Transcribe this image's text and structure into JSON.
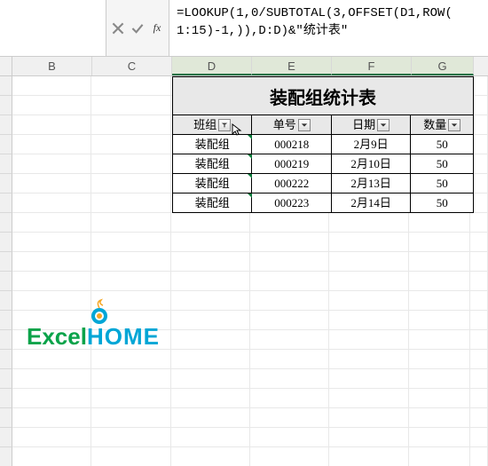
{
  "formula_bar": {
    "fx_label": "fx",
    "formula_line1": "=LOOKUP(1,0/SUBTOTAL(3,OFFSET(D1,ROW(",
    "formula_line2": "1:15)-1,)),D:D)&\"统计表\""
  },
  "columns": [
    "B",
    "C",
    "D",
    "E",
    "F",
    "G"
  ],
  "table": {
    "title": "装配组统计表",
    "headers": [
      "班组",
      "单号",
      "日期",
      "数量"
    ],
    "rows": [
      {
        "group": "装配组",
        "order": "000218",
        "date": "2月9日",
        "qty": "50"
      },
      {
        "group": "装配组",
        "order": "000219",
        "date": "2月10日",
        "qty": "50"
      },
      {
        "group": "装配组",
        "order": "000222",
        "date": "2月13日",
        "qty": "50"
      },
      {
        "group": "装配组",
        "order": "000223",
        "date": "2月14日",
        "qty": "50"
      }
    ]
  },
  "logo": {
    "part1": "Excel",
    "part2": "HOME"
  }
}
